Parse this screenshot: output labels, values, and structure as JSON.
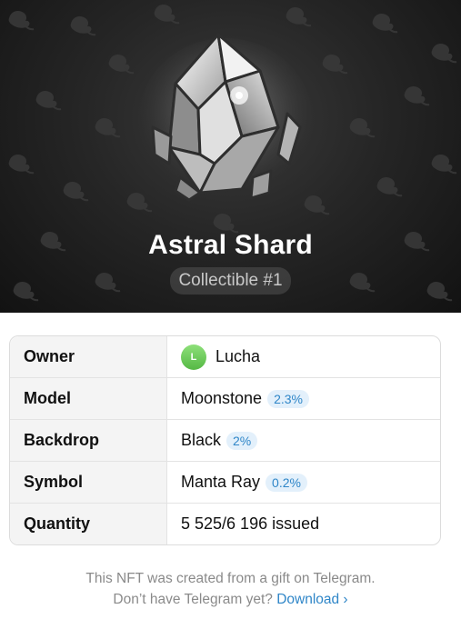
{
  "header": {
    "title": "Astral Shard",
    "subtitle": "Collectible #1",
    "backdrop_color": "#1f1f1f",
    "pattern_icon": "manta-ray-icon"
  },
  "attributes": {
    "owner": {
      "label": "Owner",
      "name": "Lucha",
      "avatar_letter": "L",
      "avatar_color": "#6ccb5f"
    },
    "model": {
      "label": "Model",
      "value": "Moonstone",
      "rarity": "2.3%"
    },
    "backdrop": {
      "label": "Backdrop",
      "value": "Black",
      "rarity": "2%"
    },
    "symbol": {
      "label": "Symbol",
      "value": "Manta Ray",
      "rarity": "0.2%"
    },
    "quantity": {
      "label": "Quantity",
      "value": "5 525/6 196 issued"
    }
  },
  "footer": {
    "line1": "This NFT was created from a gift on Telegram.",
    "line2": "Don’t have Telegram yet?",
    "link": "Download ›",
    "link_color": "#2f86c8"
  }
}
